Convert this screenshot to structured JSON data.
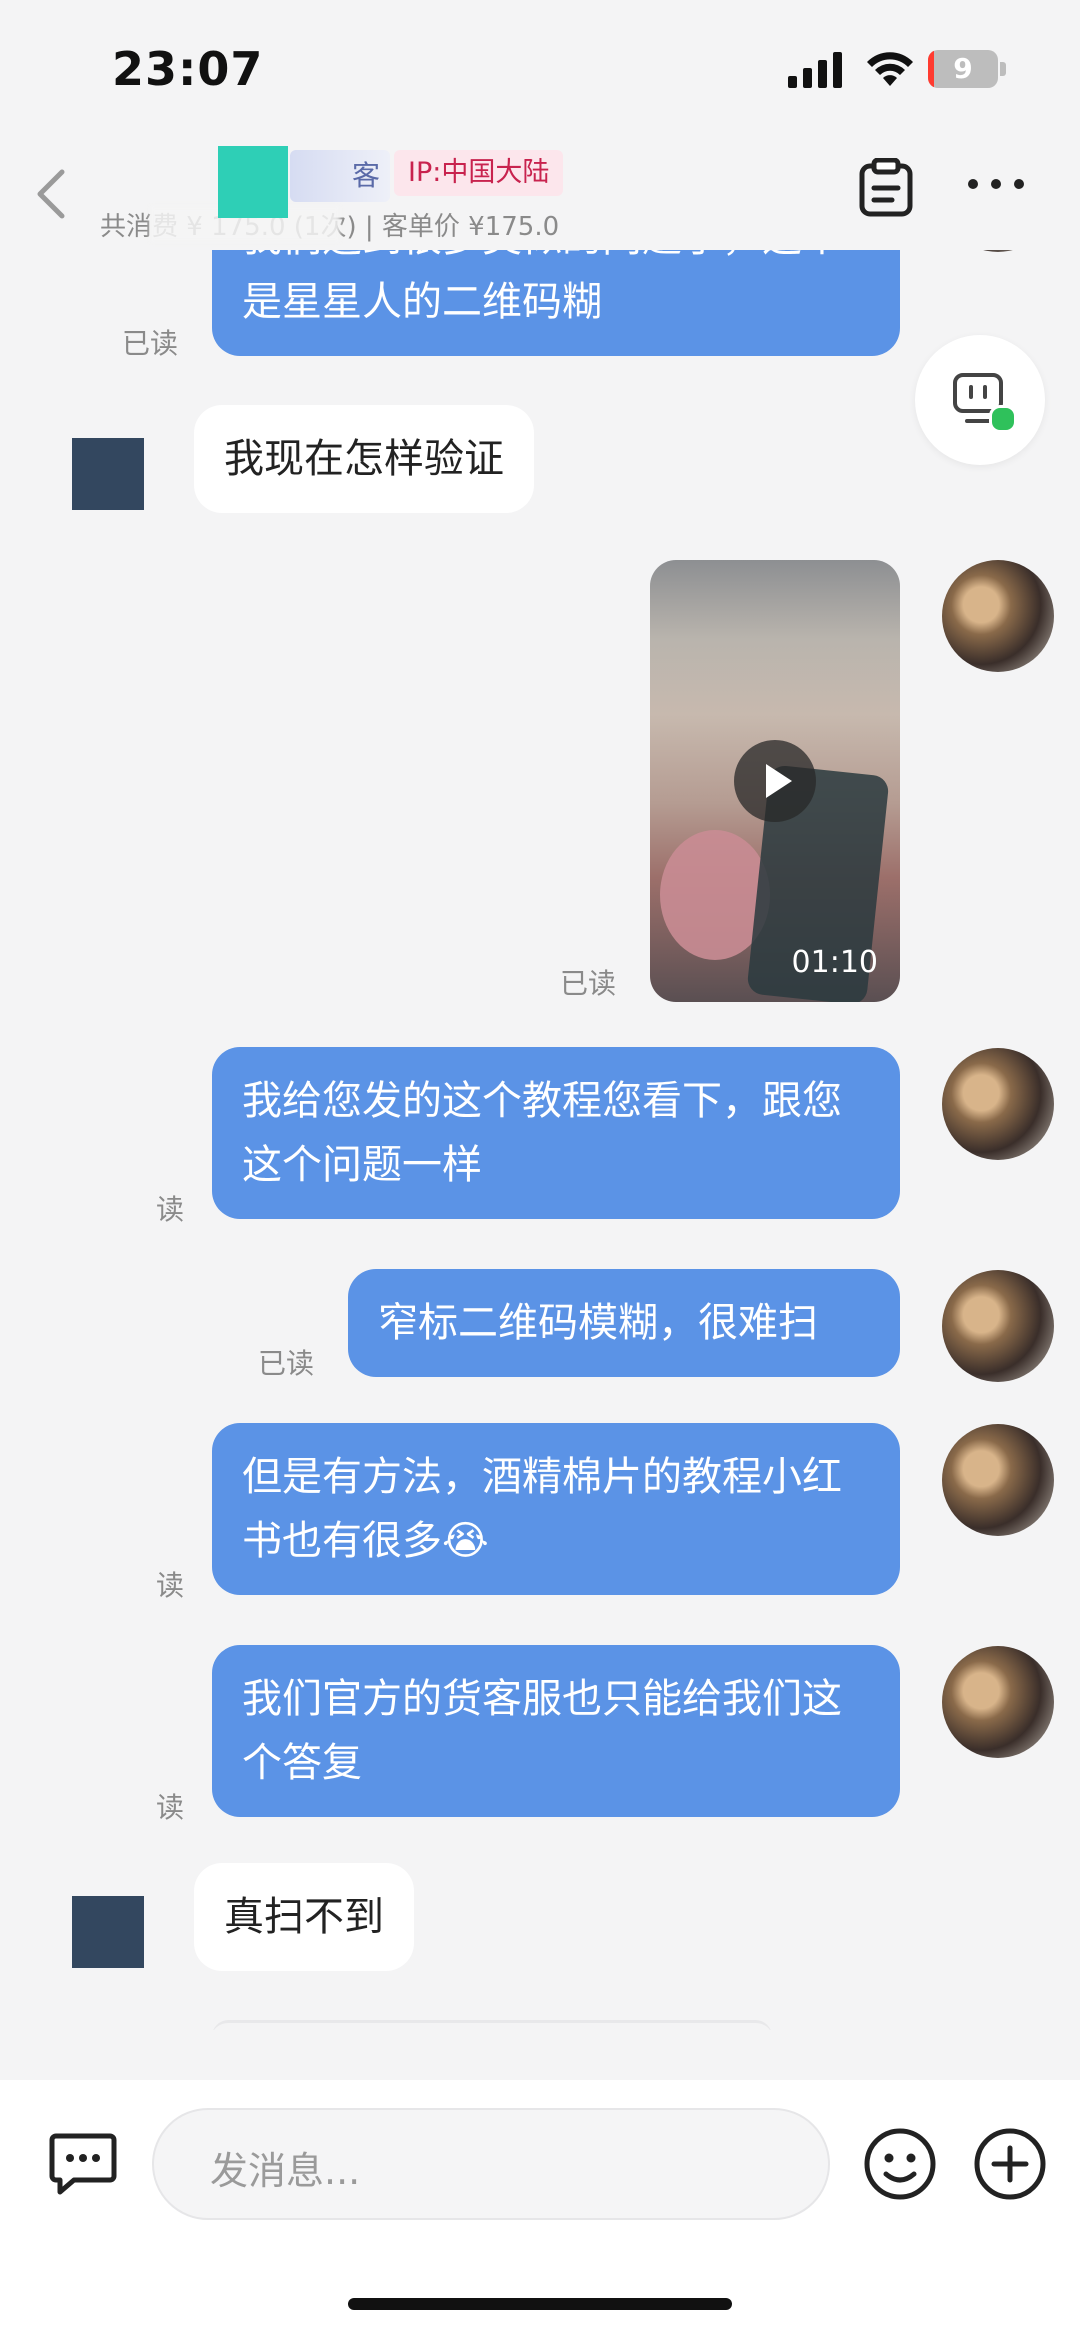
{
  "status_bar": {
    "time": "23:07",
    "battery": "9"
  },
  "header": {
    "name_suffix": "客",
    "ip_tag": "IP:中国大陆",
    "sub_info": "共消费 ¥ 175.0 (1次) | 客单价 ¥175.0"
  },
  "messages": [
    {
      "id": "m0",
      "side": "right",
      "text": "我们遇到很多类似的问题了，这个是星星人的二维码糊",
      "read": "已读"
    },
    {
      "id": "m1",
      "side": "left",
      "text": "我现在怎样验证"
    },
    {
      "id": "m2",
      "side": "right",
      "type": "video",
      "duration": "01:10",
      "read": "已读"
    },
    {
      "id": "m3",
      "side": "right",
      "text": "我给您发的这个教程您看下，跟您这个问题一样",
      "read": "读"
    },
    {
      "id": "m4",
      "side": "right",
      "text": "窄标二维码模糊，很难扫",
      "read": "已读"
    },
    {
      "id": "m5",
      "side": "right",
      "text": "但是有方法，酒精棉片的教程小红书也有很多",
      "emoji": "😭",
      "read": "读"
    },
    {
      "id": "m6",
      "side": "right",
      "text": "我们官方的货客服也只能给我们这个答复",
      "read": "读"
    },
    {
      "id": "m7",
      "side": "left",
      "text": "真扫不到"
    }
  ],
  "input": {
    "placeholder": "发消息..."
  },
  "colors": {
    "bubble_right": "#5b93e6",
    "ip_tag_text": "#c8234e",
    "online_dot": "#2fc15b"
  }
}
